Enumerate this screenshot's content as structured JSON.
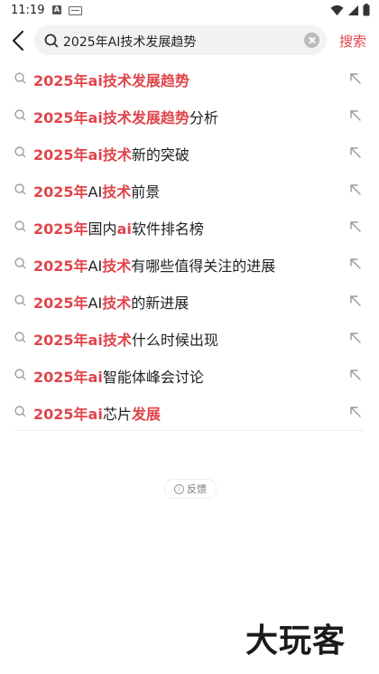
{
  "status_bar": {
    "time": "11:19",
    "app_icon_letter": "A"
  },
  "header": {
    "search_value": "2025年AI技术发展趋势",
    "search_button": "搜索"
  },
  "suggestions": [
    {
      "parts": [
        {
          "t": "2025年ai技术发展趋势",
          "hl": true
        }
      ]
    },
    {
      "parts": [
        {
          "t": "2025年ai技术发展趋势",
          "hl": true
        },
        {
          "t": "分析",
          "hl": false
        }
      ]
    },
    {
      "parts": [
        {
          "t": "2025年ai技术",
          "hl": true
        },
        {
          "t": "新的突破",
          "hl": false
        }
      ]
    },
    {
      "parts": [
        {
          "t": "2025年",
          "hl": true
        },
        {
          "t": "AI",
          "hl": false
        },
        {
          "t": "技术",
          "hl": true
        },
        {
          "t": "前景",
          "hl": false
        }
      ]
    },
    {
      "parts": [
        {
          "t": "2025年",
          "hl": true
        },
        {
          "t": "国内",
          "hl": false
        },
        {
          "t": "ai",
          "hl": true
        },
        {
          "t": "软件排名榜",
          "hl": false
        }
      ]
    },
    {
      "parts": [
        {
          "t": "2025年",
          "hl": true
        },
        {
          "t": "AI",
          "hl": false
        },
        {
          "t": "技术",
          "hl": true
        },
        {
          "t": "有哪些值得关注的进展",
          "hl": false
        }
      ]
    },
    {
      "parts": [
        {
          "t": "2025年",
          "hl": true
        },
        {
          "t": "AI",
          "hl": false
        },
        {
          "t": "技术",
          "hl": true
        },
        {
          "t": "的新进展",
          "hl": false
        }
      ]
    },
    {
      "parts": [
        {
          "t": "2025年ai技术",
          "hl": true
        },
        {
          "t": "什么时候出现",
          "hl": false
        }
      ]
    },
    {
      "parts": [
        {
          "t": "2025年ai",
          "hl": true
        },
        {
          "t": "智能体峰会讨论",
          "hl": false
        }
      ]
    },
    {
      "parts": [
        {
          "t": "2025年ai",
          "hl": true
        },
        {
          "t": "芯片",
          "hl": false
        },
        {
          "t": "发展",
          "hl": true
        }
      ]
    }
  ],
  "feedback": {
    "label": "反馈",
    "icon": "info-icon"
  },
  "watermark": "大玩客",
  "colors": {
    "accent": "#e0454b",
    "search_bg": "#f2f2f2"
  }
}
